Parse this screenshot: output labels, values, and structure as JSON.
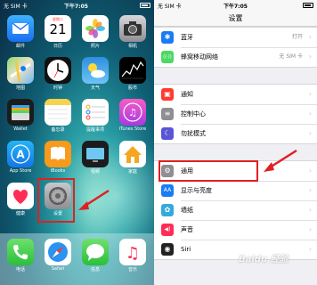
{
  "home": {
    "status": {
      "carrier": "无 SIM 卡",
      "time": "下午7:05"
    },
    "apps": [
      {
        "id": "mail",
        "label": "邮件"
      },
      {
        "id": "calendar",
        "label": "日历",
        "weekday": "星期二",
        "day": "21"
      },
      {
        "id": "photos",
        "label": "照片"
      },
      {
        "id": "camera",
        "label": "相机"
      },
      {
        "id": "maps",
        "label": "地图"
      },
      {
        "id": "clock",
        "label": "时钟"
      },
      {
        "id": "weather",
        "label": "天气"
      },
      {
        "id": "stocks",
        "label": "股市"
      },
      {
        "id": "wallet",
        "label": "Wallet"
      },
      {
        "id": "notes",
        "label": "备忘录"
      },
      {
        "id": "reminders",
        "label": "提醒事项"
      },
      {
        "id": "itunes",
        "label": "iTunes Store"
      },
      {
        "id": "appstore",
        "label": "App Store"
      },
      {
        "id": "ibooks",
        "label": "iBooks"
      },
      {
        "id": "tv",
        "label": "视频"
      },
      {
        "id": "home",
        "label": "家庭"
      },
      {
        "id": "health",
        "label": "健康"
      },
      {
        "id": "settings",
        "label": "设置"
      }
    ],
    "dock": [
      {
        "id": "phone",
        "label": "电话"
      },
      {
        "id": "safari",
        "label": "Safari"
      },
      {
        "id": "messages",
        "label": "信息"
      },
      {
        "id": "music",
        "label": "音乐"
      }
    ]
  },
  "settings": {
    "status": {
      "carrier": "无 SIM 卡",
      "time": "下午7:05"
    },
    "title": "设置",
    "group1": [
      {
        "label": "蓝牙",
        "value": "打开",
        "color": "#1a7cf5",
        "glyph": "✱"
      },
      {
        "label": "蜂窝移动网络",
        "value": "无 SIM 卡",
        "color": "#4cd964",
        "glyph": "((·))"
      }
    ],
    "group2": [
      {
        "label": "通知",
        "value": "",
        "color": "#ff3b30",
        "glyph": "▣"
      },
      {
        "label": "控制中心",
        "value": "",
        "color": "#8e8e93",
        "glyph": "≡"
      },
      {
        "label": "勿扰模式",
        "value": "",
        "color": "#5856d6",
        "glyph": "☾"
      }
    ],
    "group3": [
      {
        "label": "通用",
        "value": "",
        "color": "#8e8e93",
        "glyph": "⚙"
      },
      {
        "label": "显示与亮度",
        "value": "",
        "color": "#1a7cf5",
        "glyph": "AA"
      },
      {
        "label": "墙纸",
        "value": "",
        "color": "#34aadc",
        "glyph": "✿"
      },
      {
        "label": "声音",
        "value": "",
        "color": "#ff2d55",
        "glyph": "◀)"
      },
      {
        "label": "Siri",
        "value": "",
        "color": "#222222",
        "glyph": "◉"
      }
    ]
  },
  "watermark": "Baidu 经验",
  "colors": {
    "highlight": "#e02020"
  }
}
